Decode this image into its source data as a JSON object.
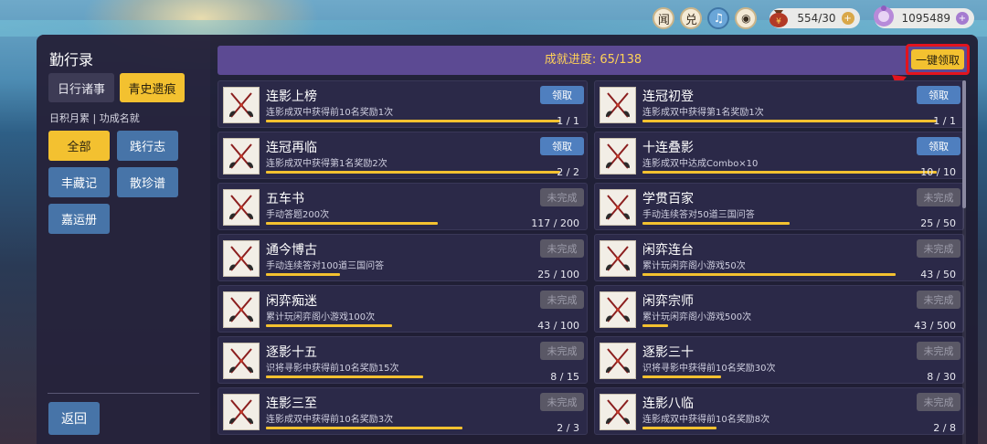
{
  "topbar": {
    "btn1": "闻",
    "btn2": "兑",
    "music_icon": "music-note-icon",
    "eye_icon": "eye-icon",
    "stamina": "554/30",
    "coins": "1095489"
  },
  "sidebar": {
    "title": "勤行录",
    "tabs": [
      "日行诸事",
      "青史遗痕"
    ],
    "active_tab": "青史遗痕",
    "subhead": "日积月累 | 功成名就",
    "filters": [
      "全部",
      "践行志",
      "丰藏记",
      "散珍谱",
      "嘉运册"
    ],
    "active_filter": "全部",
    "back": "返回"
  },
  "header": {
    "progress_label": "成就进度: 65/138",
    "claim_all": "一键领取"
  },
  "colors": {
    "accent_yellow": "#f3c130",
    "claim_blue": "#4f7fbf",
    "header_purple": "#5c4a93",
    "highlight_red": "#e3141e"
  },
  "achievements": [
    {
      "title": "连影上榜",
      "desc": "连影成双中获得前10名奖励1次",
      "count": "1 / 1",
      "progress": 1.0,
      "button": "领取",
      "state": "claim"
    },
    {
      "title": "连冠初登",
      "desc": "连影成双中获得第1名奖励1次",
      "count": "1 / 1",
      "progress": 1.0,
      "button": "领取",
      "state": "claim"
    },
    {
      "title": "连冠再临",
      "desc": "连影成双中获得第1名奖励2次",
      "count": "2 / 2",
      "progress": 1.0,
      "button": "领取",
      "state": "claim"
    },
    {
      "title": "十连叠影",
      "desc": "连影成双中达成Combo×10",
      "count": "10 / 10",
      "progress": 1.0,
      "button": "领取",
      "state": "claim"
    },
    {
      "title": "五车书",
      "desc": "手动答题200次",
      "count": "117 / 200",
      "progress": 0.585,
      "button": "未完成",
      "state": "undone"
    },
    {
      "title": "学贯百家",
      "desc": "手动连续答对50道三国问答",
      "count": "25 / 50",
      "progress": 0.5,
      "button": "未完成",
      "state": "undone"
    },
    {
      "title": "通今博古",
      "desc": "手动连续答对100道三国问答",
      "count": "25 / 100",
      "progress": 0.25,
      "button": "未完成",
      "state": "undone"
    },
    {
      "title": "闲弈连台",
      "desc": "累计玩闲弈阁小游戏50次",
      "count": "43 / 50",
      "progress": 0.86,
      "button": "未完成",
      "state": "undone"
    },
    {
      "title": "闲弈痴迷",
      "desc": "累计玩闲弈阁小游戏100次",
      "count": "43 / 100",
      "progress": 0.43,
      "button": "未完成",
      "state": "undone"
    },
    {
      "title": "闲弈宗师",
      "desc": "累计玩闲弈阁小游戏500次",
      "count": "43 / 500",
      "progress": 0.086,
      "button": "未完成",
      "state": "undone"
    },
    {
      "title": "逐影十五",
      "desc": "识将寻影中获得前10名奖励15次",
      "count": "8 / 15",
      "progress": 0.533,
      "button": "未完成",
      "state": "undone"
    },
    {
      "title": "逐影三十",
      "desc": "识将寻影中获得前10名奖励30次",
      "count": "8 / 30",
      "progress": 0.267,
      "button": "未完成",
      "state": "undone"
    },
    {
      "title": "连影三至",
      "desc": "连影成双中获得前10名奖励3次",
      "count": "2 / 3",
      "progress": 0.667,
      "button": "未完成",
      "state": "undone"
    },
    {
      "title": "连影八临",
      "desc": "连影成双中获得前10名奖励8次",
      "count": "2 / 8",
      "progress": 0.25,
      "button": "未完成",
      "state": "undone"
    }
  ]
}
